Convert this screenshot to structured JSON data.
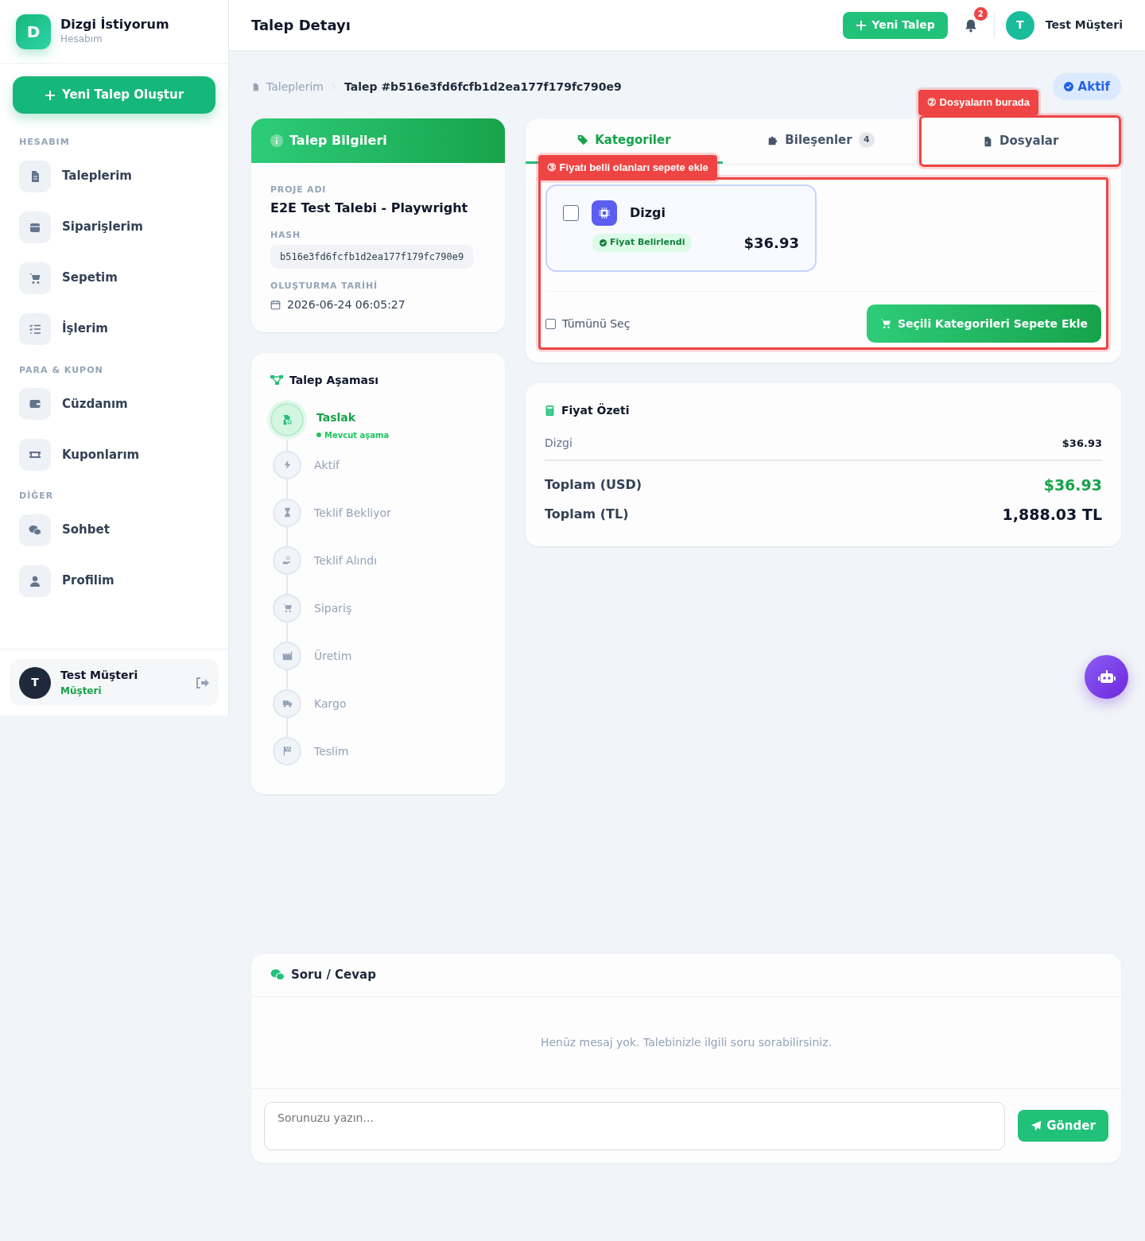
{
  "sidebar": {
    "brand": {
      "logo_letter": "D",
      "title": "Dizgi İstiyorum",
      "subtitle": "Hesabım"
    },
    "new_button": "Yeni Talep Oluştur",
    "sections": [
      {
        "heading": "HESABIM",
        "items": [
          {
            "label": "Taleplerim"
          },
          {
            "label": "Siparişlerim"
          },
          {
            "label": "Sepetim"
          },
          {
            "label": "İşlerim"
          }
        ]
      },
      {
        "heading": "PARA & KUPON",
        "items": [
          {
            "label": "Cüzdanım"
          },
          {
            "label": "Kuponlarım"
          }
        ]
      },
      {
        "heading": "DİĞER",
        "items": [
          {
            "label": "Sohbet"
          },
          {
            "label": "Profilim"
          }
        ]
      }
    ],
    "user": {
      "avatar_letter": "T",
      "name": "Test Müşteri",
      "role": "Müşteri"
    }
  },
  "header": {
    "title": "Talep Detayı",
    "new_button": "Yeni Talep",
    "notification_count": "2",
    "user": {
      "avatar_letter": "T",
      "name": "Test Müşteri"
    }
  },
  "breadcrumb": {
    "items": [
      "Taleplerim"
    ],
    "current": "Talep #b516e3fd6fcfb1d2ea177f179fc790e9"
  },
  "status_badge": "Aktif",
  "info_card": {
    "title": "Talep Bilgileri",
    "fields": [
      {
        "label": "PROJE ADI",
        "value": "E2E Test Talebi - Playwright",
        "kind": "title"
      },
      {
        "label": "HASH",
        "value": "b516e3fd6fcfb1d2ea177f179fc790e9",
        "kind": "code"
      },
      {
        "label": "OLUŞTURMA TARİHİ",
        "value": "2026-06-24 06:05:27",
        "kind": "date"
      }
    ]
  },
  "stages": {
    "title": "Talep Aşaması",
    "steps": [
      {
        "label": "Taslak",
        "selected": true,
        "note": "Mevcut aşama"
      },
      {
        "label": "Aktif",
        "selected": false
      },
      {
        "label": "Teklif Bekliyor",
        "selected": false
      },
      {
        "label": "Teklif Alındı",
        "selected": false
      },
      {
        "label": "Sipariş",
        "selected": false
      },
      {
        "label": "Üretim",
        "selected": false
      },
      {
        "label": "Kargo",
        "selected": false
      },
      {
        "label": "Teslim",
        "selected": false
      }
    ]
  },
  "tabs": [
    {
      "label": "Kategoriler",
      "selected": true,
      "highlighted": false
    },
    {
      "label": "Bileşenler",
      "count": "4",
      "selected": false,
      "highlighted": false
    },
    {
      "label": "Dosyalar",
      "selected": false,
      "highlighted": true
    }
  ],
  "categories": {
    "highlighted": true,
    "items": [
      {
        "name": "Dizgi",
        "checked": false,
        "status": "Fiyat Belirlendi",
        "price": "$36.93"
      }
    ],
    "select_all": {
      "label": "Tümünü Seç",
      "checked": false
    },
    "add_button": "Seçili Kategorileri Sepete Ekle"
  },
  "annotations": [
    {
      "text": "② Dosyaların burada"
    },
    {
      "text": "③ Fiyatı belli olanları sepete ekle"
    }
  ],
  "price_summary": {
    "title": "Fiyat Özeti",
    "lines": [
      {
        "label": "Dizgi",
        "value": "$36.93"
      }
    ],
    "totals": [
      {
        "label": "Toplam (USD)",
        "value": "$36.93",
        "kind": "usd"
      },
      {
        "label": "Toplam (TL)",
        "value": "1,888.03 TL",
        "kind": "tl"
      }
    ]
  },
  "chat": {
    "title": "Soru / Cevap",
    "empty_text": "Henüz mesaj yok. Talebinizle ilgili soru sorabilirsiniz.",
    "input": {
      "placeholder": "Sorunuzu yazın..."
    },
    "send_button": "Gönder"
  }
}
